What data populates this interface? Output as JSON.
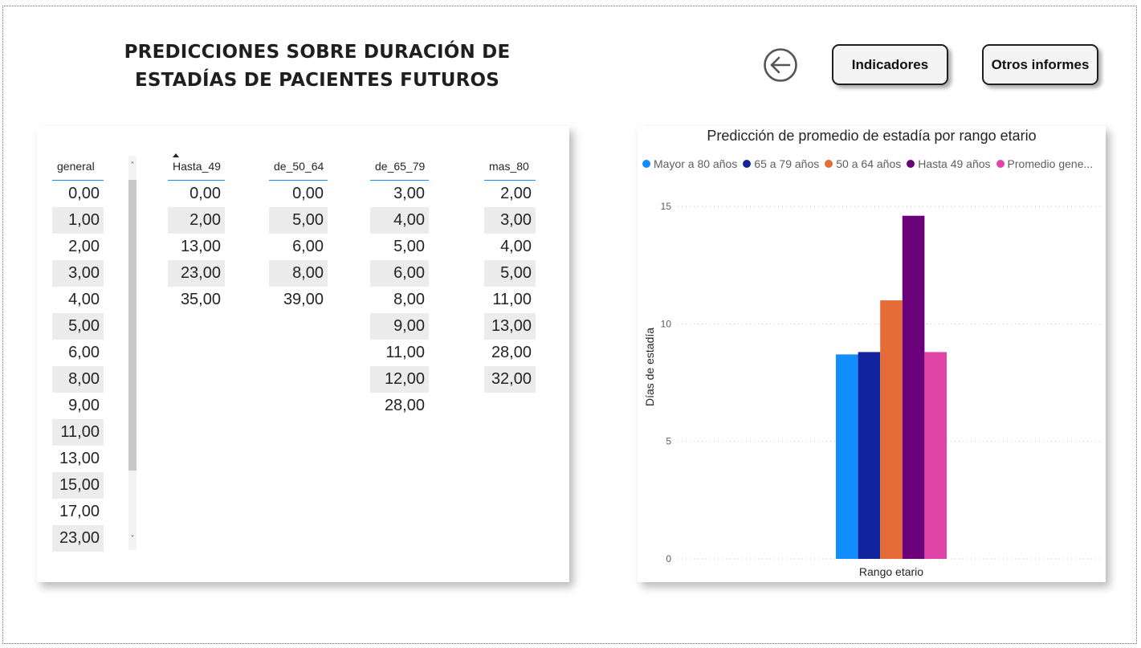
{
  "header": {
    "title_line1": "PREDICCIONES SOBRE DURACIÓN DE",
    "title_line2": "ESTADÍAS DE PACIENTES FUTUROS"
  },
  "nav": {
    "back_icon": "arrow-left-circle-icon",
    "indicadores_label": "Indicadores",
    "otros_informes_label": "Otros informes"
  },
  "table": {
    "columns": [
      {
        "header": "general",
        "values": [
          "0,00",
          "1,00",
          "2,00",
          "3,00",
          "4,00",
          "5,00",
          "6,00",
          "8,00",
          "9,00",
          "11,00",
          "13,00",
          "15,00",
          "17,00",
          "23,00"
        ]
      },
      {
        "header": "Hasta_49",
        "values": [
          "0,00",
          "2,00",
          "13,00",
          "23,00",
          "35,00"
        ]
      },
      {
        "header": "de_50_64",
        "values": [
          "0,00",
          "5,00",
          "6,00",
          "8,00",
          "39,00"
        ]
      },
      {
        "header": "de_65_79",
        "values": [
          "3,00",
          "4,00",
          "5,00",
          "6,00",
          "8,00",
          "9,00",
          "11,00",
          "12,00",
          "28,00"
        ]
      },
      {
        "header": "mas_80",
        "values": [
          "2,00",
          "3,00",
          "4,00",
          "5,00",
          "11,00",
          "13,00",
          "28,00",
          "32,00"
        ]
      }
    ],
    "scroll_up_icon": "chevron-up-icon",
    "scroll_down_icon": "chevron-down-icon",
    "scroll_up_glyph": "˄",
    "scroll_down_glyph": "˅"
  },
  "chart_data": {
    "type": "bar",
    "title": "Predicción de promedio de estadía por rango etario",
    "xlabel": "Rango etario",
    "ylabel": "Días de estadía",
    "ylim": [
      0,
      15
    ],
    "yticks": [
      "0",
      "5",
      "10",
      "15"
    ],
    "grid": true,
    "legend_position": "top",
    "categories": [
      ""
    ],
    "series": [
      {
        "name": "Mayor a 80 años",
        "color": "#118dff",
        "values": [
          8.7
        ]
      },
      {
        "name": "65 a 79 años",
        "color": "#12239e",
        "values": [
          8.8
        ]
      },
      {
        "name": "50 a 64 años",
        "color": "#e66c37",
        "values": [
          11.0
        ]
      },
      {
        "name": "Hasta 49 años",
        "color": "#6b007b",
        "values": [
          14.6
        ]
      },
      {
        "name": "Promedio gene...",
        "color": "#e044a7",
        "values": [
          8.8
        ]
      }
    ]
  }
}
